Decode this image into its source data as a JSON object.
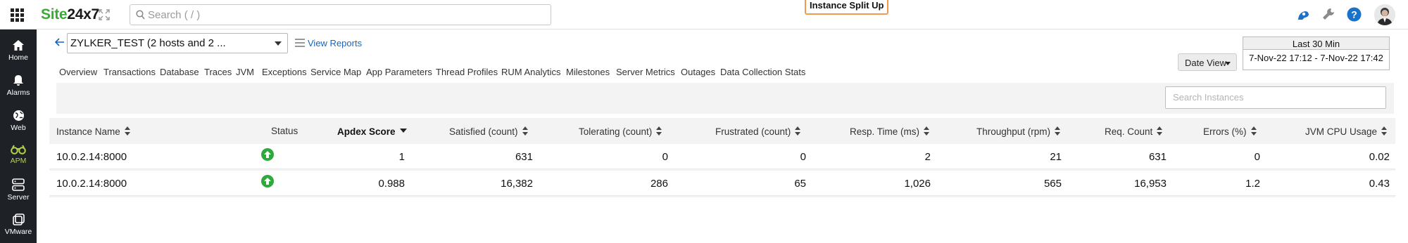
{
  "topbar": {
    "brand_part1": "Site",
    "brand_part2": "24x7",
    "search_placeholder": "Search ( / )"
  },
  "sidebar": {
    "items": [
      {
        "label": "Home",
        "icon": "home-icon"
      },
      {
        "label": "Alarms",
        "icon": "bell-icon"
      },
      {
        "label": "Web",
        "icon": "globe-icon"
      },
      {
        "label": "APM",
        "icon": "binoculars-icon",
        "active": true
      },
      {
        "label": "Server",
        "icon": "server-icon"
      },
      {
        "label": "VMware",
        "icon": "vmware-icon"
      }
    ]
  },
  "header": {
    "monitor": "ZYLKER_TEST (2 hosts and 2 ...",
    "view_reports": "View Reports"
  },
  "tabs": [
    "Overview",
    "Transactions",
    "Database",
    "Traces",
    "JVM",
    "Exceptions",
    "Service Map",
    "App Parameters",
    "Thread Profiles",
    "RUM Analytics",
    "Milestones",
    "Server Metrics",
    "Outages",
    "Data Collection Stats",
    "Instance Split Up"
  ],
  "active_tab": "Instance Split Up",
  "date": {
    "view_label": "Date View",
    "period_label": "Last 30 Min",
    "range": "7-Nov-22 17:12 - 7-Nov-22 17:42"
  },
  "instance_search_placeholder": "Search Instances",
  "table": {
    "columns": [
      "Instance Name",
      "Status",
      "Apdex Score",
      "Satisfied (count)",
      "Tolerating (count)",
      "Frustrated (count)",
      "Resp. Time (ms)",
      "Throughput (rpm)",
      "Req. Count",
      "Errors (%)",
      "JVM CPU Usage"
    ],
    "sorted_column": "Apdex Score",
    "rows": [
      {
        "instance": "10.0.2.14:8000",
        "status": "up",
        "apdex": "1",
        "satisfied": "631",
        "tolerating": "0",
        "frustrated": "0",
        "resp_time": "2",
        "throughput": "21",
        "req_count": "631",
        "errors": "0",
        "jvm_cpu": "0.02"
      },
      {
        "instance": "10.0.2.14:8000",
        "status": "up",
        "apdex": "0.988",
        "satisfied": "16,382",
        "tolerating": "286",
        "frustrated": "65",
        "resp_time": "1,026",
        "throughput": "565",
        "req_count": "16,953",
        "errors": "1.2",
        "jvm_cpu": "0.43"
      }
    ]
  },
  "colors": {
    "brand_green": "#3aa935",
    "sidebar_bg": "#1e2227",
    "active_nav": "#b5d44a",
    "tab_highlight": "#f39a4e",
    "status_up": "#2eaa3c",
    "link_blue": "#1565c0"
  }
}
